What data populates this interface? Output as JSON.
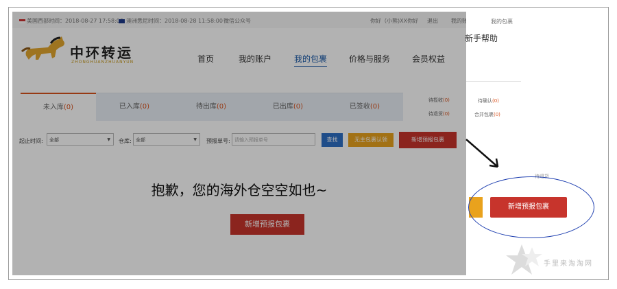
{
  "topbar": {
    "us_time": "美国西部时间：2018-08-27 17:58:00",
    "au_time": "澳洲悉尼时间：2018-08-28 11:58:00",
    "wechat": "微信公众号",
    "greeting": "你好（小熊)XX你好",
    "logout": "退出",
    "my_account": "我的账户",
    "my_parcels": "我的包裹"
  },
  "logo": {
    "cn": "中环转运",
    "en": "ZHONGHUANZHUANYUN"
  },
  "nav": [
    "首页",
    "我的账户",
    "我的包裹",
    "价格与服务",
    "会员权益",
    "新手帮助"
  ],
  "tabs": [
    {
      "label": "未入库",
      "count": "(0)"
    },
    {
      "label": "已入库",
      "count": "(0)"
    },
    {
      "label": "待出库",
      "count": "(0)"
    },
    {
      "label": "已出库",
      "count": "(0)"
    },
    {
      "label": "已签收",
      "count": "(0)"
    }
  ],
  "side_stats": [
    {
      "label": "待揽收",
      "count": "(0)"
    },
    {
      "label": "待确认",
      "count": "(0)"
    },
    {
      "label": "待退货",
      "count": "(0)"
    },
    {
      "label": "合并包裹",
      "count": "(0)"
    }
  ],
  "filters": {
    "time_label": "起止时间:",
    "time_value": "全部",
    "warehouse_label": "仓库:",
    "warehouse_value": "全部",
    "number_label": "预报单号:",
    "number_placeholder": "请输入预报单号",
    "search_btn": "查找",
    "unclaimed_btn": "无主包裹认领",
    "new_btn": "新增预报包裹"
  },
  "empty": {
    "message": "抱歉，您的海外仓空空如也~",
    "button": "新增预报包裹"
  },
  "zoom": {
    "label": "待退货",
    "button": "新增预报包裹"
  },
  "watermark": {
    "text": "手里来淘淘网"
  },
  "colors": {
    "accent_red": "#c7342c",
    "accent_blue": "#1a5aa8",
    "orange": "#e9a21d"
  }
}
